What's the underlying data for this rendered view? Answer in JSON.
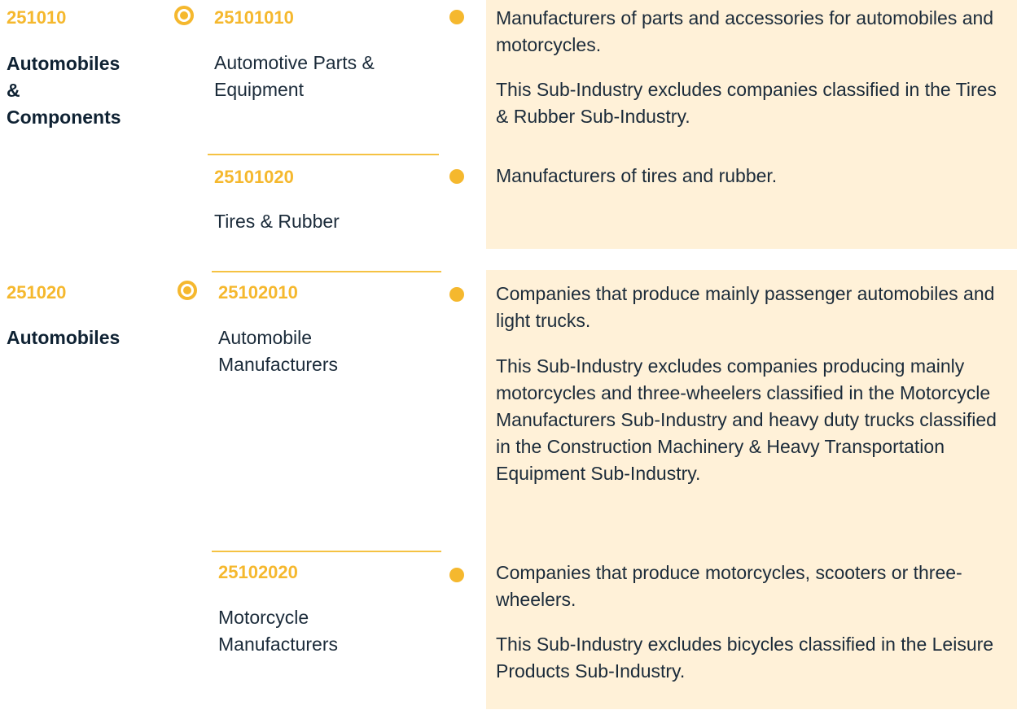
{
  "groups": [
    {
      "industry_code": "251010",
      "industry_name": "Automobiles & Components",
      "sub_industries": [
        {
          "code": "25101010",
          "name": "Automotive Parts & Equipment",
          "description": "Manufacturers of parts and accessories for automobiles and motorcycles.",
          "exclusion": "This Sub-Industry excludes companies classified in the Tires & Rubber Sub-Industry."
        },
        {
          "code": "25101020",
          "name": "Tires & Rubber",
          "description": "Manufacturers of tires and rubber."
        }
      ]
    },
    {
      "industry_code": "251020",
      "industry_name": "Automobiles",
      "sub_industries": [
        {
          "code": "25102010",
          "name": "Automobile Manufacturers",
          "description": "Companies that produce mainly passenger automobiles and light trucks.",
          "exclusion": "This Sub-Industry excludes companies producing mainly motorcycles and three-wheelers classified in the Motorcycle Manufacturers Sub-Industry and heavy duty trucks classified in the Construction Machinery & Heavy Transportation Equipment Sub-Industry."
        },
        {
          "code": "25102020",
          "name": "Motorcycle Manufacturers",
          "description": "Companies that produce motorcycles, scooters or three-wheelers.",
          "exclusion": "This Sub-Industry excludes bicycles classified in the Leisure Products Sub-Industry."
        }
      ]
    }
  ],
  "colors": {
    "accent": "#f5b82e",
    "panel_background": "#fff1d8",
    "text": "#1b2b3a"
  }
}
